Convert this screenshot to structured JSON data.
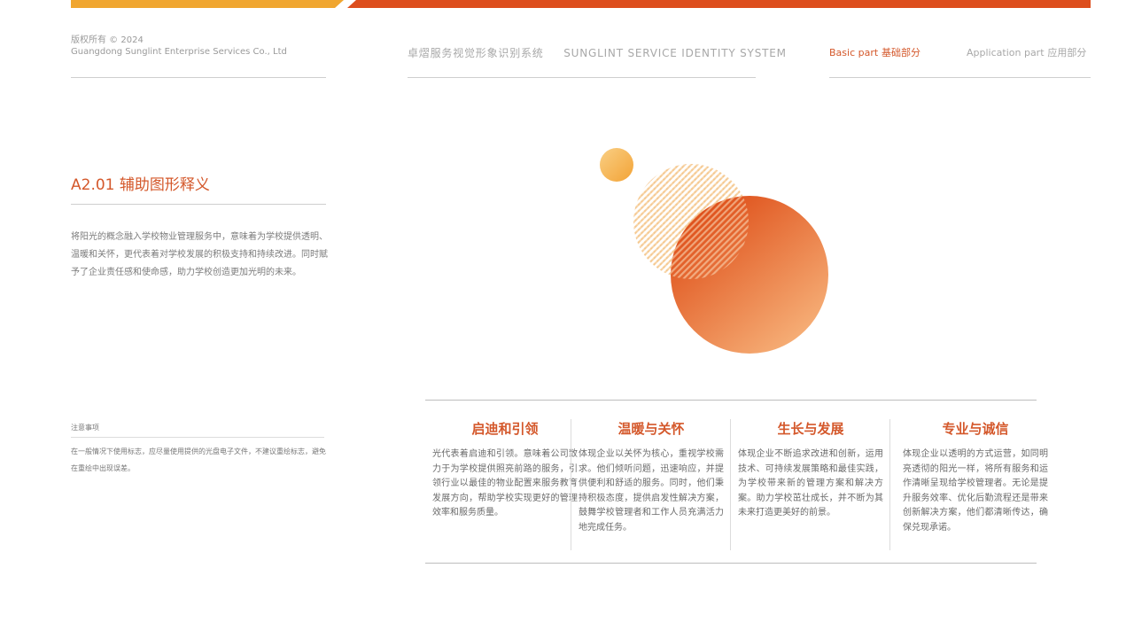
{
  "header": {
    "copyright_line1": "版权所有 © 2024",
    "copyright_line2": "Guangdong Sunglint Enterprise Services Co., Ltd",
    "system_cn": "卓熠服务视觉形象识别系统",
    "system_en": "SUNGLINT SERVICE IDENTITY SYSTEM",
    "nav_basic_en": "Basic part",
    "nav_basic_cn": "基础部分",
    "nav_app_en": "Application part",
    "nav_app_cn": "应用部分"
  },
  "colors": {
    "accent": "#d4582b",
    "yellow": "#f0a630",
    "orange_light": "#f5b97a"
  },
  "section": {
    "title": "A2.01 辅助图形释义",
    "description": "将阳光的概念融入学校物业管理服务中，意味着为学校提供透明、温暖和关怀，更代表着对学校发展的积极支持和持续改进。同时赋予了企业责任感和使命感，助力学校创造更加光明的未来。"
  },
  "notes": {
    "title": "注意事项",
    "text": "在一般情况下使用标志，应尽量使用提供的光盘电子文件，不建议重绘标志，避免在重绘中出现误差。"
  },
  "values": [
    {
      "title": "启迪和引领",
      "text": "光代表着启迪和引领。意味着公司致力于为学校提供照亮前路的服务，引领行业以最佳的物业配置来服务教育发展方向，帮助学校实现更好的管理效率和服务质量。"
    },
    {
      "title": "温暖与关怀",
      "text": "体现企业以关怀为核心，重视学校需求。他们倾听问题，迅速响应，并提供便利和舒适的服务。同时，他们秉持积极态度，提供启发性解决方案，鼓舞学校管理者和工作人员充满活力地完成任务。"
    },
    {
      "title": "生长与发展",
      "text": "体现企业不断追求改进和创新，运用技术、可持续发展策略和最佳实践，为学校带来新的管理方案和解决方案。助力学校茁壮成长，并不断为其未来打造更美好的前景。"
    },
    {
      "title": "专业与诚信",
      "text": "体现企业以透明的方式运营，如同明亮透彻的阳光一样，将所有服务和运作清晰呈现给学校管理者。无论是提升服务效率、优化后勤流程还是带来创新解决方案，他们都清晰传达，确保兑现承诺。"
    }
  ]
}
